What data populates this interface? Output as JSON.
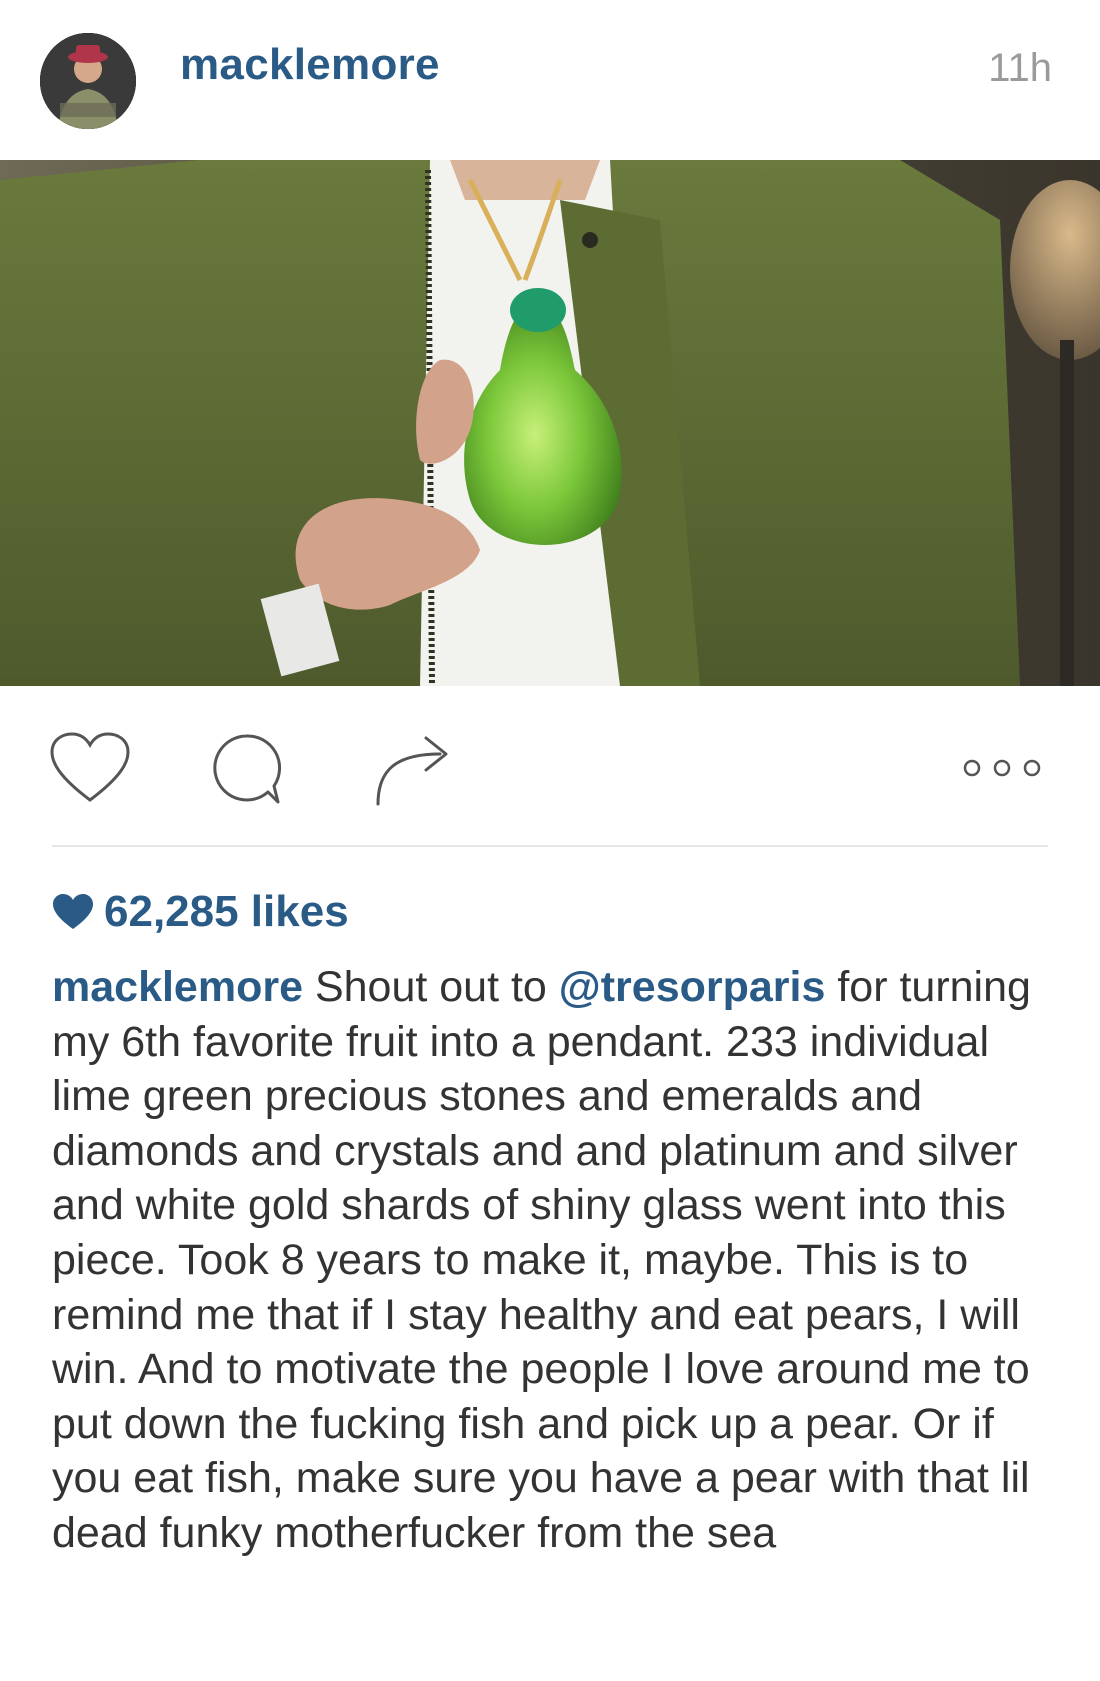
{
  "post": {
    "username": "macklemore",
    "time_ago": "11h",
    "likes": "62,285 likes",
    "caption": {
      "user": "macklemore",
      "text_before_mention": " Shout out to ",
      "mention": "@tresorparis",
      "text_after_mention": " for turning my 6th favorite fruit into a pendant. 233 individual lime green precious stones and emeralds and diamonds and crystals and and platinum and silver and white gold shards of shiny glass went into this piece. Took 8 years to make it, maybe.  This is to remind me that if I stay healthy and eat pears, I will win.  And to motivate the people I love around me to put down the fucking fish and pick up a pear.  Or if you eat fish, make sure you have a pear with that lil dead funky motherfucker from the sea"
    }
  },
  "icons": {
    "like": "heart-outline-icon",
    "comment": "speech-bubble-icon",
    "share": "share-arrow-icon",
    "more": "more-dots-icon",
    "likes_marker": "heart-filled-icon"
  },
  "colors": {
    "link_blue": "#2a5b87",
    "text": "#333333",
    "muted": "#9a9a9a",
    "jacket_green": "#5b6b35",
    "pear_green": "#7cc83a"
  }
}
